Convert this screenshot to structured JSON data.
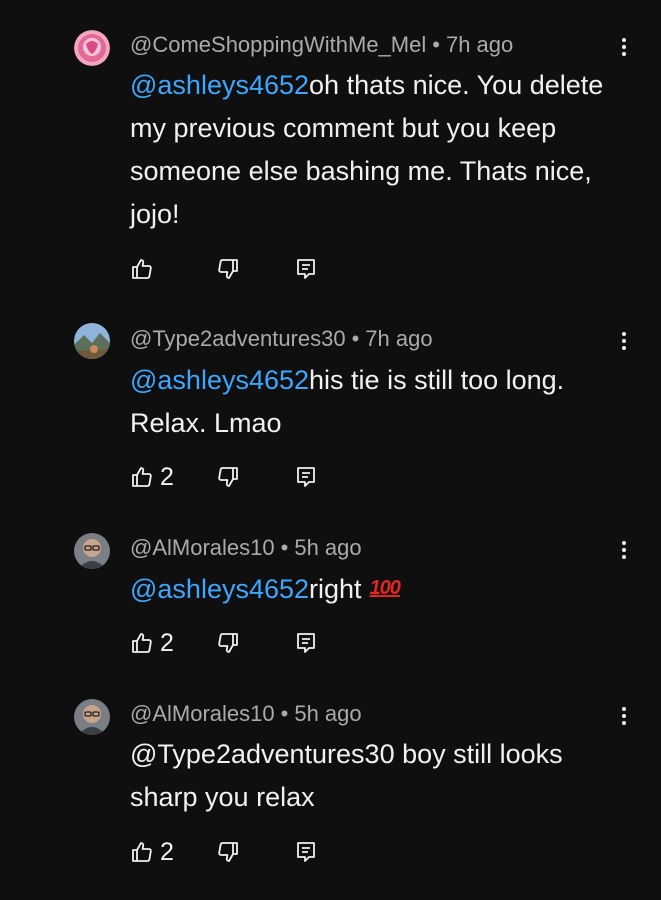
{
  "comments": [
    {
      "author": "@ComeShoppingWithMe_Mel",
      "time": "7h ago",
      "mention": "@ashleys4652",
      "text": "oh thats nice. You delete my previous comment but you keep someone else bashing me. Thats nice, jojo!",
      "likes": "",
      "avatar": "pink-heart-avatar"
    },
    {
      "author": "@Type2adventures30",
      "time": "7h ago",
      "mention": "@ashleys4652",
      "text": "his tie is still too long. Relax. Lmao",
      "likes": "2",
      "avatar": "mountain-photo-avatar"
    },
    {
      "author": "@AlMorales10",
      "time": "5h ago",
      "mention": "@ashleys4652",
      "text": "right",
      "emoji": "100",
      "likes": "2",
      "avatar": "man-glasses-avatar"
    },
    {
      "author": "@AlMorales10",
      "time": "5h ago",
      "mention": "",
      "text": "@Type2adventures30 boy still looks sharp you relax",
      "likes": "2",
      "avatar": "man-glasses-avatar"
    }
  ],
  "separator": "•",
  "colors": {
    "background": "#0f0f0f",
    "text": "#f1f1f1",
    "meta": "#aaaaaa",
    "mention": "#3ea6ff",
    "emoji": "#e3261f"
  }
}
